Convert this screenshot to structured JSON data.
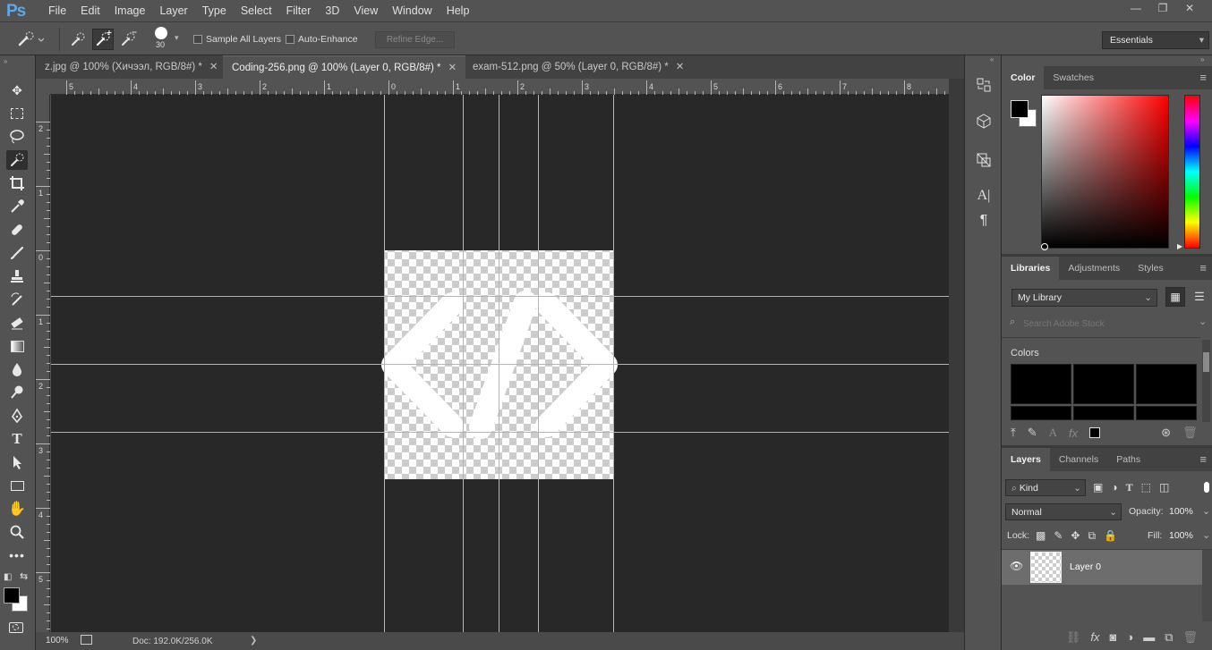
{
  "app": {
    "logo": "Ps"
  },
  "menu": [
    "File",
    "Edit",
    "Image",
    "Layer",
    "Type",
    "Select",
    "Filter",
    "3D",
    "View",
    "Window",
    "Help"
  ],
  "window_controls": {
    "minimize": "—",
    "restore": "❐",
    "close": "✕"
  },
  "options": {
    "brush_size": "30",
    "sample_all_layers": "Sample All Layers",
    "auto_enhance": "Auto-Enhance",
    "refine_edge": "Refine Edge...",
    "workspace": "Essentials"
  },
  "tabs": [
    {
      "label": "z.jpg @ 100% (Хичээл, RGB/8#) *",
      "close": "✕"
    },
    {
      "label": "Coding-256.png @ 100% (Layer 0, RGB/8#) *",
      "close": "✕"
    },
    {
      "label": "exam-512.png @ 50% (Layer 0, RGB/8#) *",
      "close": "✕"
    }
  ],
  "ruler_top": [
    "5",
    "4",
    "3",
    "2",
    "1",
    "0",
    "1",
    "2",
    "3",
    "4",
    "5",
    "6",
    "7",
    "8"
  ],
  "ruler_left": [
    "2",
    "1",
    "0",
    "1",
    "2",
    "3",
    "4",
    "5"
  ],
  "status": {
    "zoom": "100%",
    "doc": "Doc: 192.0K/256.0K",
    "arrow": "❯"
  },
  "color_panel": {
    "tabs": [
      "Color",
      "Swatches"
    ]
  },
  "libraries_panel": {
    "tabs": [
      "Libraries",
      "Adjustments",
      "Styles"
    ],
    "library": "My Library",
    "search_placeholder": "Search Adobe Stock",
    "colors_label": "Colors"
  },
  "layers_panel": {
    "tabs": [
      "Layers",
      "Channels",
      "Paths"
    ],
    "filter": "Kind",
    "blend_mode": "Normal",
    "opacity_label": "Opacity:",
    "opacity_value": "100%",
    "lock_label": "Lock:",
    "fill_label": "Fill:",
    "fill_value": "100%",
    "layer_name": "Layer 0"
  },
  "colors": {
    "guide": "#3ee6f0",
    "canvas_bg": "#282828",
    "accent_logo": "#5fa8e8"
  }
}
